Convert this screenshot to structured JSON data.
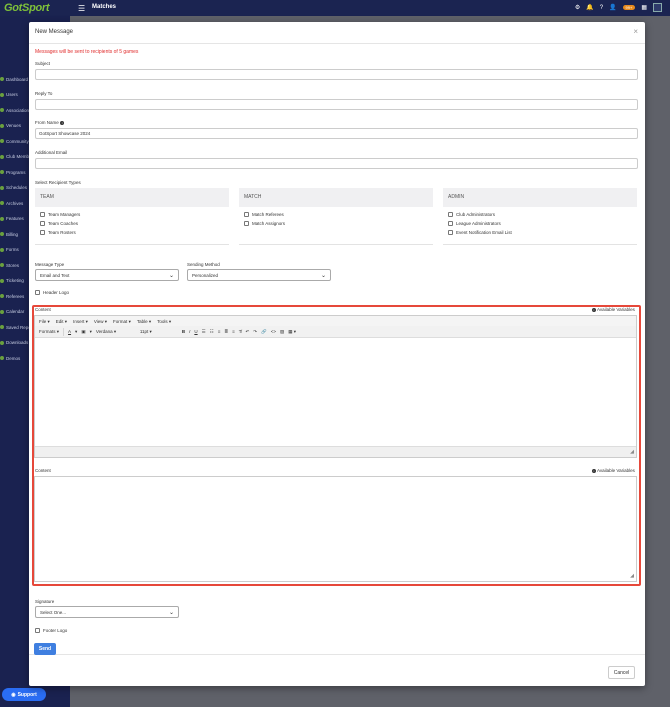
{
  "app": {
    "logo": "GotSport",
    "page_title": "Matches",
    "notification_count": "99+",
    "support_label": "Support"
  },
  "sidebar": {
    "items": [
      {
        "label": "Dashboard"
      },
      {
        "label": "Users"
      },
      {
        "label": "Associations"
      },
      {
        "label": "Venues"
      },
      {
        "label": "Community"
      },
      {
        "label": "Club Members"
      },
      {
        "label": "Programs"
      },
      {
        "label": "Schedules"
      },
      {
        "label": "Archives"
      },
      {
        "label": "Features"
      },
      {
        "label": "Billing"
      },
      {
        "label": "Forms"
      },
      {
        "label": "Stores"
      },
      {
        "label": "Ticketing"
      },
      {
        "label": "Referees"
      },
      {
        "label": "Calendar"
      },
      {
        "label": "Saved Reports"
      },
      {
        "label": "Downloads"
      },
      {
        "label": "Demos"
      }
    ]
  },
  "modal": {
    "title": "New Message",
    "close_symbol": "×",
    "warning_prefix": "Messages will be sent to recipients of",
    "warning_count": "5 games",
    "subject_label": "Subject",
    "subject_value": "",
    "reply_to_label": "Reply To",
    "reply_to_value": "",
    "from_name_label": "From Name",
    "from_name_value": "GotSport Showcase 2024",
    "additional_email_label": "Additional Email",
    "additional_email_value": "",
    "recipient_types_label": "Select Recipient Types",
    "recipient_groups": [
      {
        "title": "TEAM",
        "options": [
          "Team Managers",
          "Team Coaches",
          "Team Rosters"
        ]
      },
      {
        "title": "MATCH",
        "options": [
          "Match Referees",
          "Match Assignors"
        ]
      },
      {
        "title": "ADMIN",
        "options": [
          "Club Administrators",
          "League Administrators",
          "Event Notification Email List"
        ]
      }
    ],
    "message_type_label": "Message Type",
    "message_type_value": "Email and Text",
    "sending_method_label": "Sending Method",
    "sending_method_value": "Personalized",
    "header_logo_label": "Header Logo",
    "content_label": "Content",
    "available_variables_label": "Available Variables",
    "editor_menu": [
      "File",
      "Edit",
      "Insert",
      "View",
      "Format",
      "Table",
      "Tools"
    ],
    "editor_toolbar": {
      "formats": "Formats",
      "font": "Verdana",
      "size": "11pt"
    },
    "content2_label": "Content",
    "signature_label": "Signature",
    "signature_value": "Select One...",
    "footer_logo_label": "Footer Logo",
    "send_label": "Send",
    "cancel_label": "Cancel"
  },
  "colors": {
    "accent": "#3f7fe0",
    "warning": "#e02d2d",
    "highlight_border": "#e6483a",
    "sidebar_bg": "#1a2250"
  }
}
